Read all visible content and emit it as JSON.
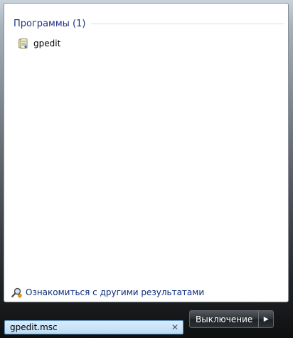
{
  "results": {
    "group_title": "Программы (1)",
    "items": [
      {
        "label": "gpedit",
        "icon": "policy-document-icon"
      }
    ],
    "see_more_label": "Ознакомиться с другими результатами",
    "see_more_icon": "search-results-icon"
  },
  "search": {
    "value": "gpedit.msc",
    "clear_icon": "clear-icon"
  },
  "power": {
    "shutdown_label": "Выключение",
    "arrow_icon": "chevron-right-icon"
  }
}
